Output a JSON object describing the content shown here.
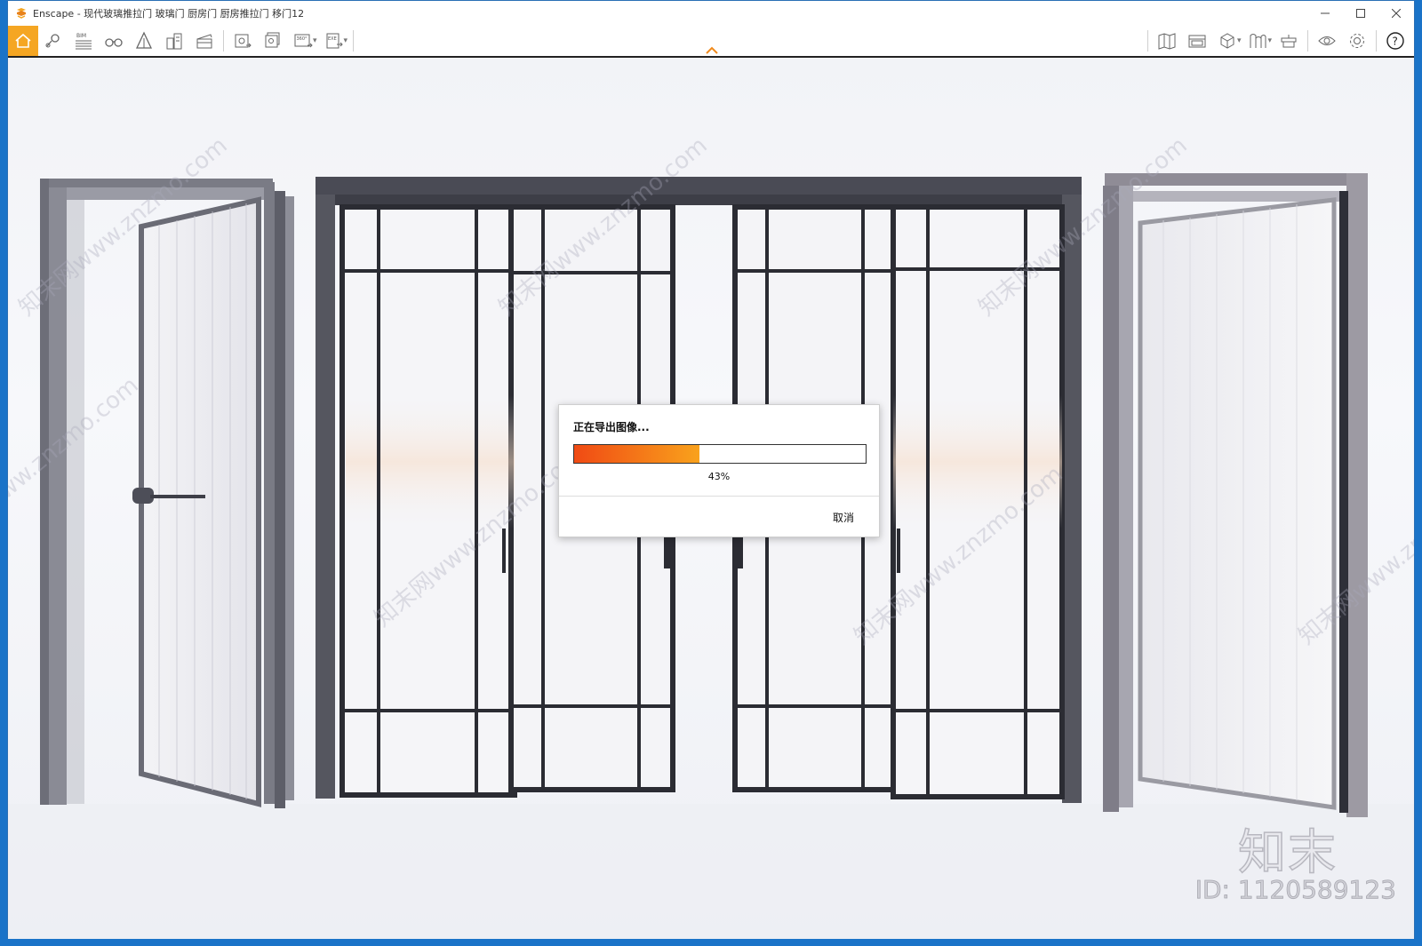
{
  "window": {
    "title": "Enscape - 现代玻璃推拉门 玻璃门 厨房门 厨房推拉门 移门12",
    "controls": [
      "minimize",
      "maximize",
      "close"
    ]
  },
  "toolbar": {
    "left_tools": [
      {
        "icon": "home-icon",
        "active": true
      },
      {
        "icon": "location-pin-icon"
      },
      {
        "icon": "bim-icon",
        "label": "BIM"
      },
      {
        "icon": "binoculars-icon"
      },
      {
        "icon": "asset-library-icon"
      },
      {
        "icon": "buildings-icon"
      },
      {
        "icon": "clapperboard-icon"
      },
      {
        "icon": "screenshot-icon"
      },
      {
        "icon": "batch-render-icon"
      },
      {
        "icon": "panorama-360-icon",
        "label": "360°"
      },
      {
        "icon": "export-exe-icon",
        "label": "EXE"
      }
    ],
    "right_tools": [
      {
        "icon": "map-icon"
      },
      {
        "icon": "views-icon"
      },
      {
        "icon": "cube-view-icon"
      },
      {
        "icon": "section-icon"
      },
      {
        "icon": "collaborate-icon"
      },
      {
        "icon": "eye-icon"
      },
      {
        "icon": "settings-gear-icon"
      },
      {
        "icon": "help-icon"
      }
    ]
  },
  "viewport": {
    "watermarks": [
      "知末网www.znzmo.com"
    ],
    "brand": {
      "logo": "知末",
      "id": "ID: 1120589123"
    }
  },
  "dialog": {
    "title": "正在导出图像...",
    "progress": 0.43,
    "progress_label": "43%",
    "cancel_label": "取消",
    "accent_start": "#f04a14",
    "accent_end": "#f9a21c"
  },
  "colors": {
    "accent": "#f5a623",
    "desktop": "#1a73c8"
  }
}
